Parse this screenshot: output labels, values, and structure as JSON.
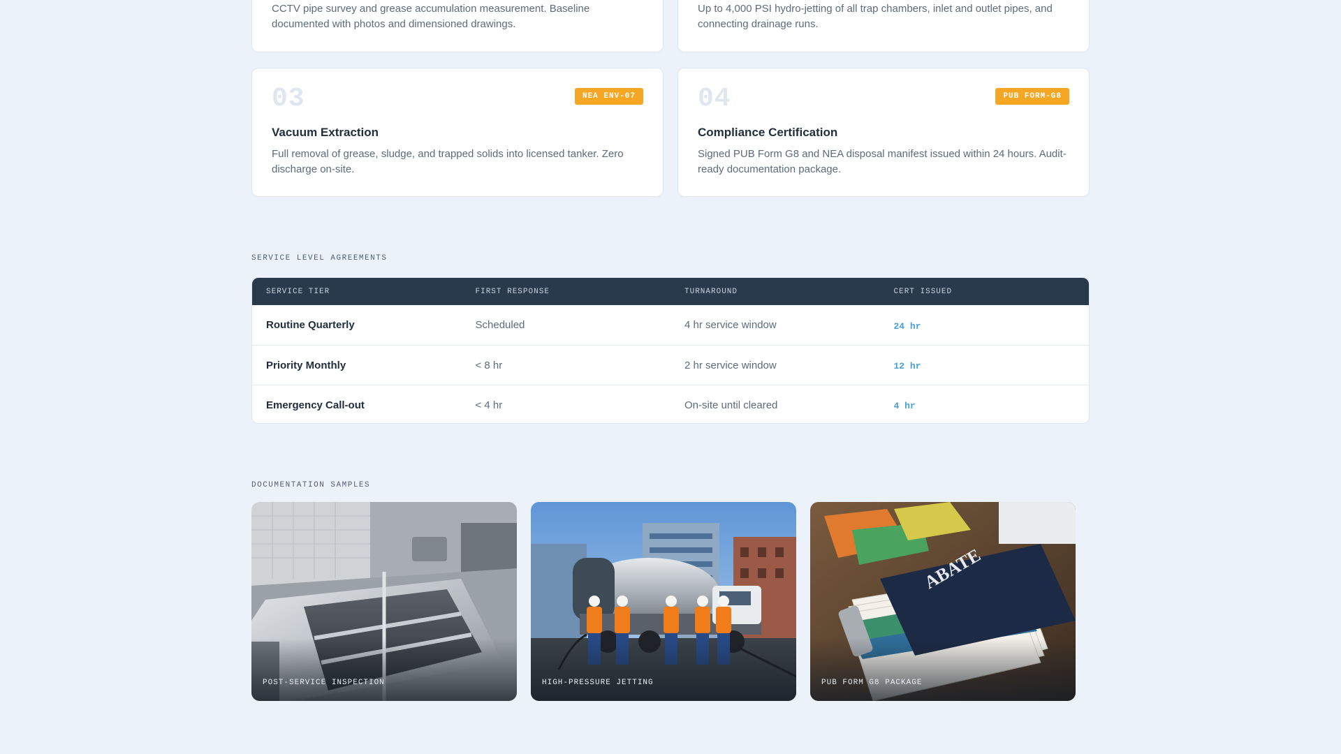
{
  "steps": [
    {
      "desc": "CCTV pipe survey and grease accumulation measurement. Baseline documented with photos and dimensioned drawings."
    },
    {
      "desc": "Up to 4,000 PSI hydro-jetting of all trap chambers, inlet and outlet pipes, and connecting drainage runs."
    },
    {
      "number": "03",
      "badge": "NEA ENV-07",
      "title": "Vacuum Extraction",
      "desc": "Full removal of grease, sludge, and trapped solids into licensed tanker. Zero discharge on-site."
    },
    {
      "number": "04",
      "badge": "PUB FORM-G8",
      "title": "Compliance Certification",
      "desc": "Signed PUB Form G8 and NEA disposal manifest issued within 24 hours. Audit-ready documentation package."
    }
  ],
  "sla": {
    "section_label": "SERVICE LEVEL AGREEMENTS",
    "headers": [
      "SERVICE TIER",
      "FIRST RESPONSE",
      "TURNAROUND",
      "CERT ISSUED"
    ],
    "rows": [
      {
        "tier": "Routine Quarterly",
        "first_response": "Scheduled",
        "turnaround": "4 hr service window",
        "cert": "24 hr"
      },
      {
        "tier": "Priority Monthly",
        "first_response": "< 8 hr",
        "turnaround": "2 hr service window",
        "cert": "12 hr"
      },
      {
        "tier": "Emergency Call-out",
        "first_response": "< 4 hr",
        "turnaround": "On-site until cleared",
        "cert": "4 hr"
      }
    ]
  },
  "docs": {
    "section_label": "DOCUMENTATION SAMPLES",
    "tiles": [
      {
        "caption": "POST-SERVICE INSPECTION",
        "icon": "grease-trap-photo"
      },
      {
        "caption": "HIGH-PRESSURE JETTING",
        "icon": "vacuum-tanker-crew-photo"
      },
      {
        "caption": "PUB FORM G8 PACKAGE",
        "icon": "document-folder-photo",
        "folder_text": "ABATE"
      }
    ]
  },
  "colors": {
    "background": "#ecf2fa",
    "badge": "#f5a623",
    "table_header": "#2a3a4d",
    "cert_accent": "#4a9fd8"
  }
}
